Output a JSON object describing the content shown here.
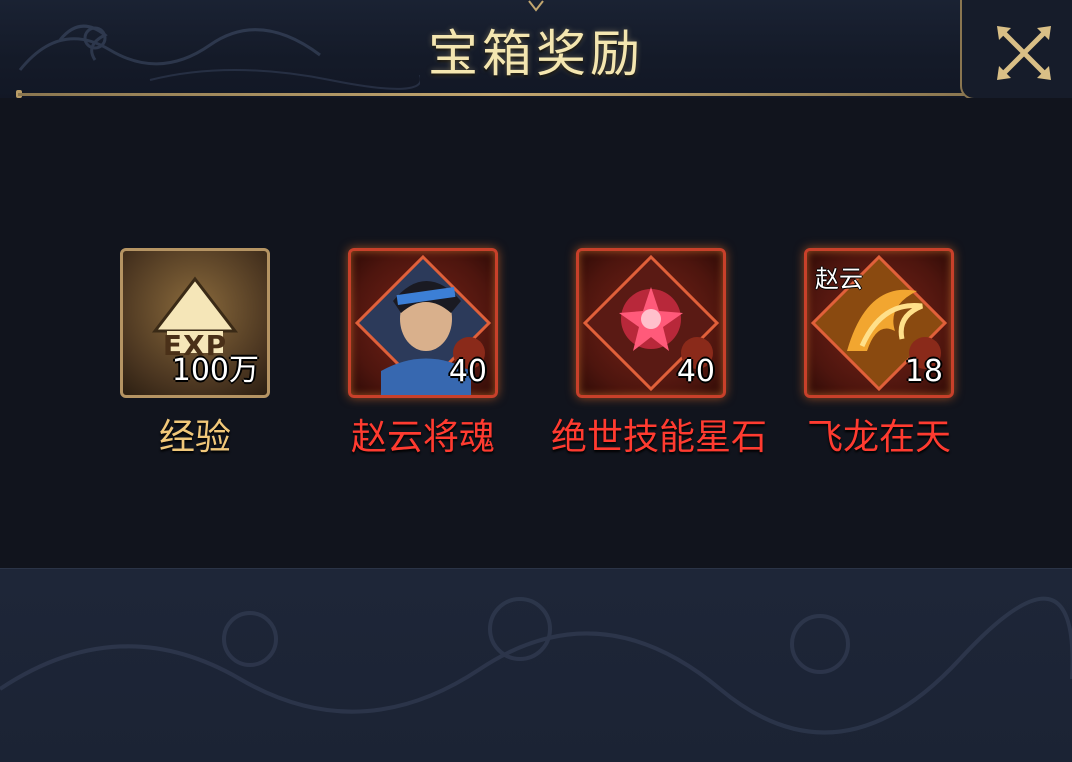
{
  "dialog": {
    "title": "宝箱奖励",
    "accent_color": "#c2a66f",
    "close_icon": "crossed-swords-close-icon"
  },
  "rewards": [
    {
      "name": "经验",
      "count": "100万",
      "badge": "EXP",
      "icon": "exp-arrow-icon",
      "name_color": "#f1c87a",
      "rarity": "normal"
    },
    {
      "name": "赵云将魂",
      "count": "40",
      "icon": "hero-portrait-icon",
      "name_color": "#ff3b30",
      "rarity": "red"
    },
    {
      "name": "绝世技能星石",
      "count": "40",
      "icon": "star-stone-icon",
      "name_color": "#ff3b30",
      "rarity": "red"
    },
    {
      "name": "飞龙在天",
      "count": "18",
      "owner": "赵云",
      "icon": "skill-scroll-icon",
      "name_color": "#ff3b30",
      "rarity": "red"
    }
  ]
}
